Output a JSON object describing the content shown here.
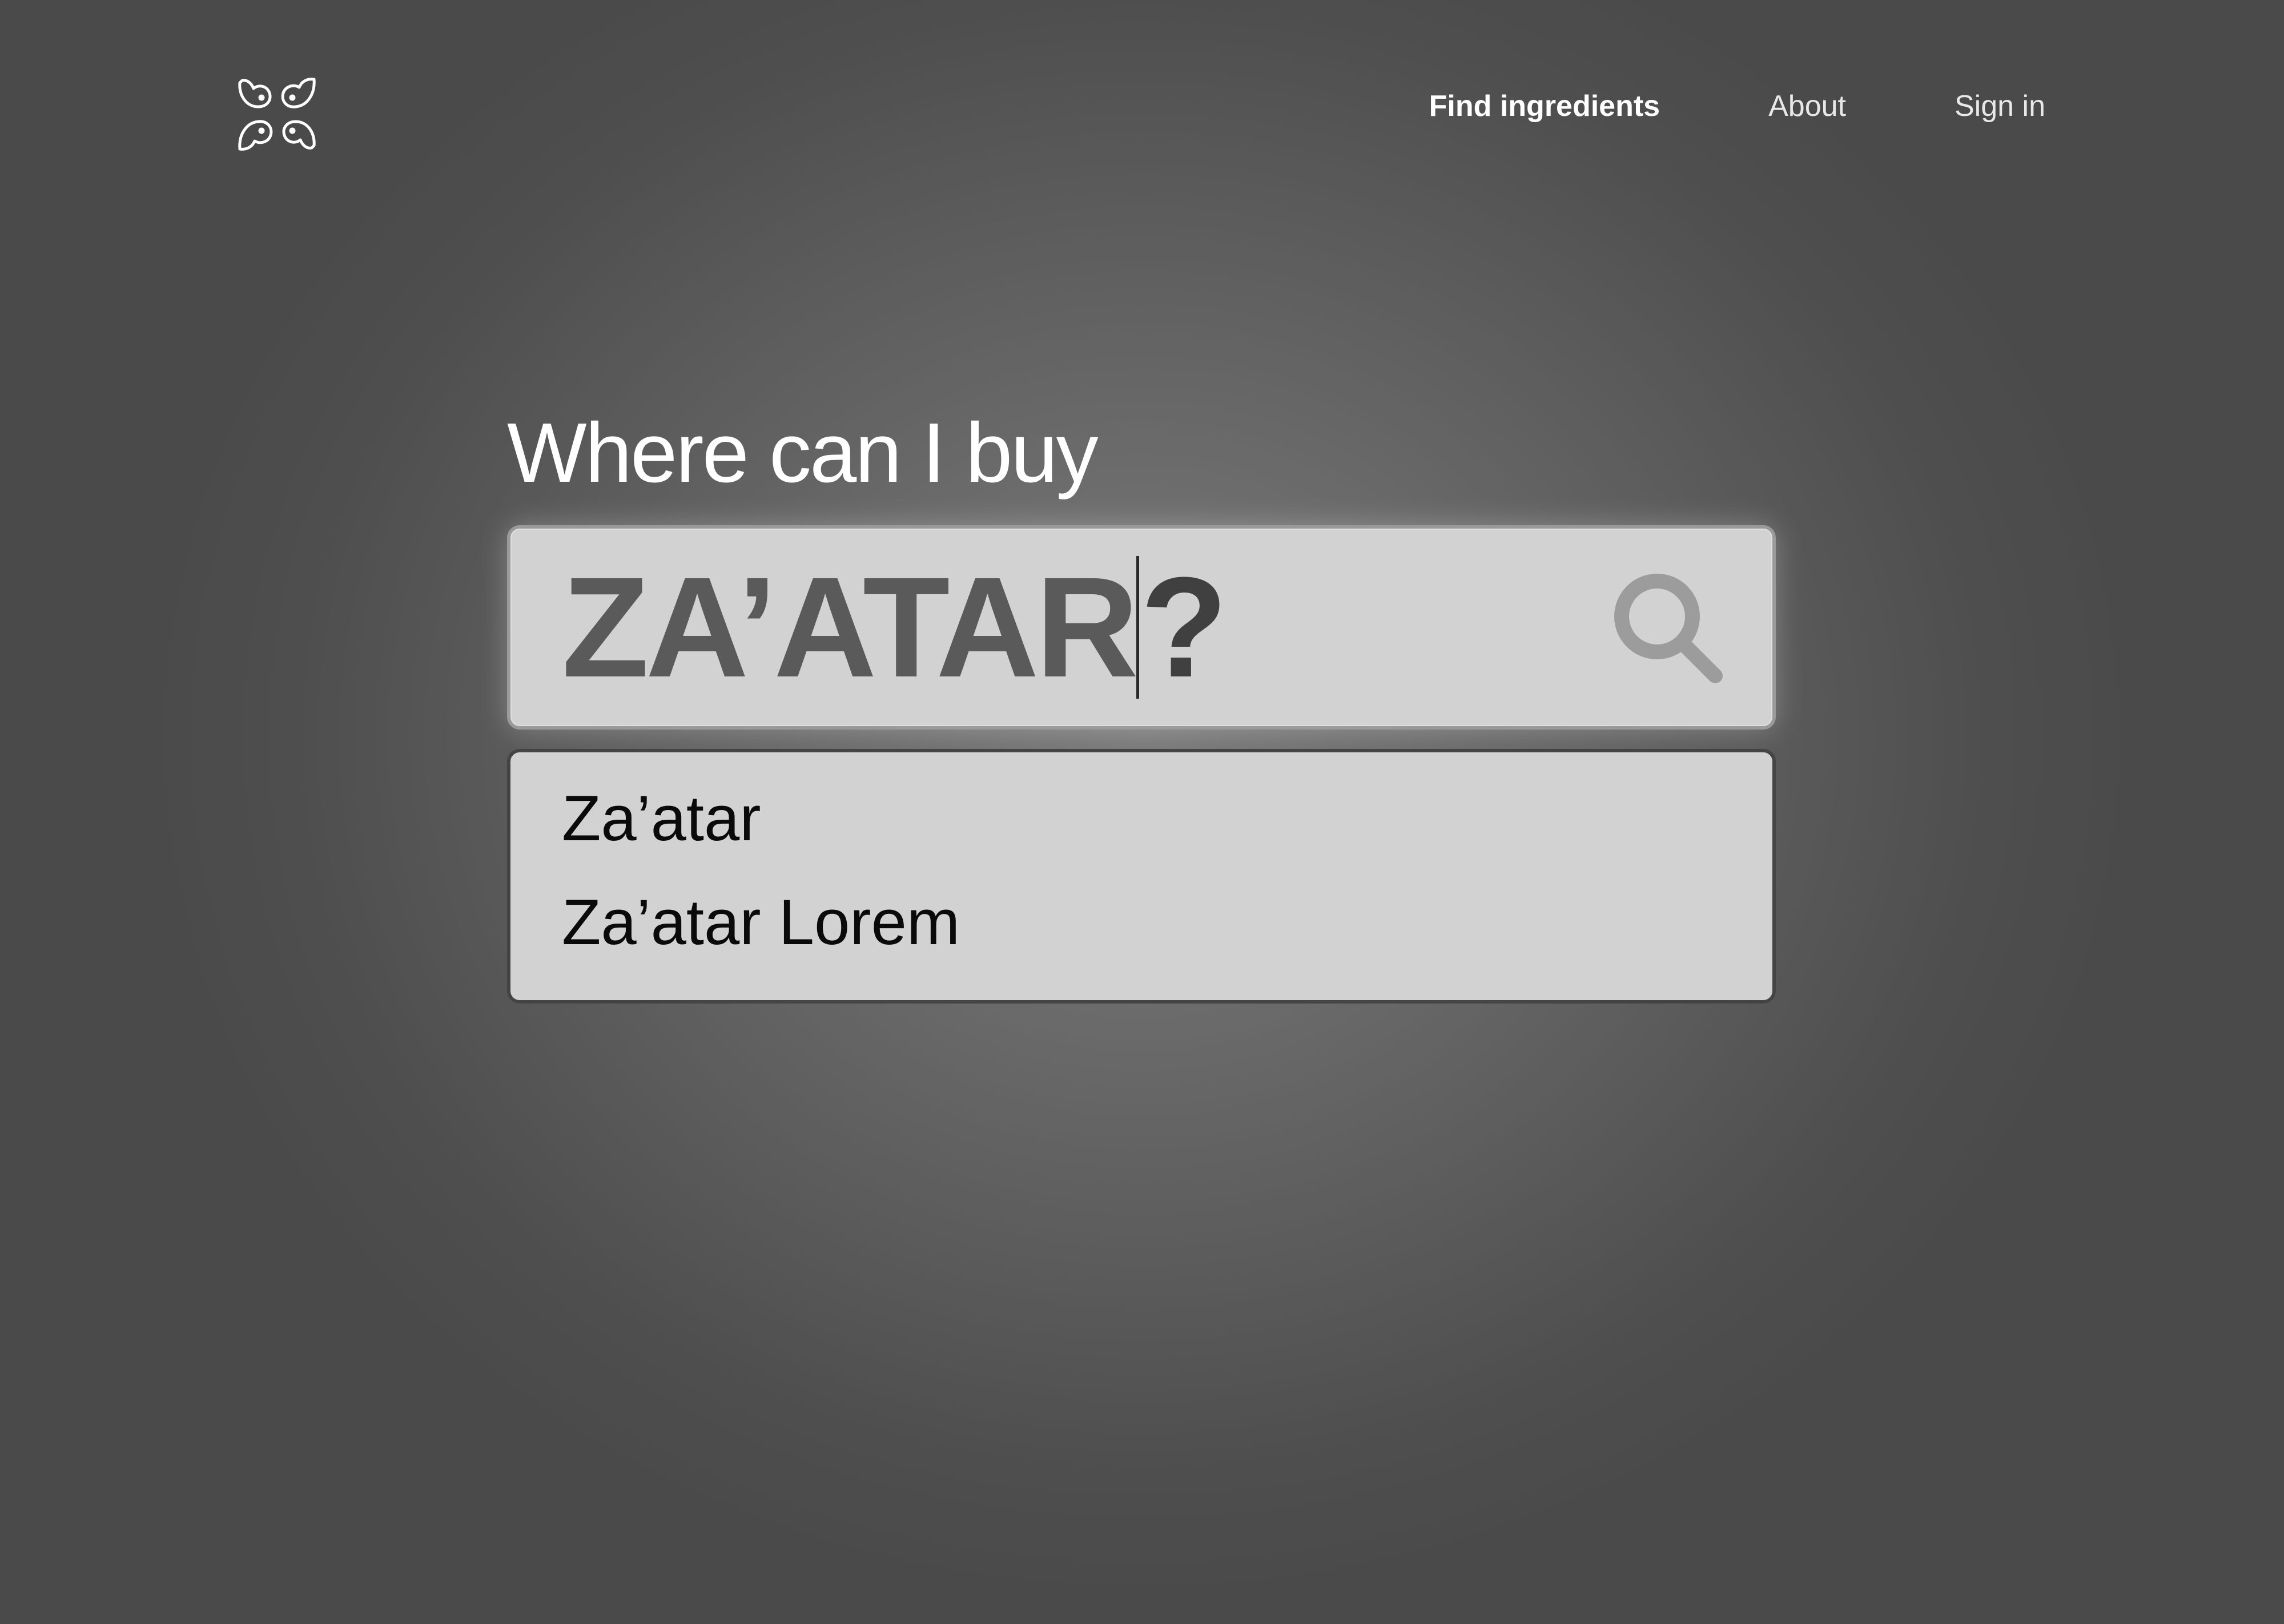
{
  "nav": {
    "links": [
      {
        "label": "Find ingredients",
        "active": true
      },
      {
        "label": "About",
        "active": false
      },
      {
        "label": "Sign in",
        "active": false
      }
    ]
  },
  "logo": {
    "icon": "four-birds-logo-icon"
  },
  "hero": {
    "heading": "Where can I buy"
  },
  "search": {
    "value": "ZA’ATAR",
    "suffix": "?",
    "icon": "search-icon"
  },
  "suggestions": [
    {
      "label": "Za’atar"
    },
    {
      "label": "Za’atar Lorem"
    }
  ],
  "colors": {
    "background": "#4a4a4a",
    "search_box": "#d2d2d2",
    "search_text": "#5a5a5a",
    "nav_text": "#ffffff"
  }
}
